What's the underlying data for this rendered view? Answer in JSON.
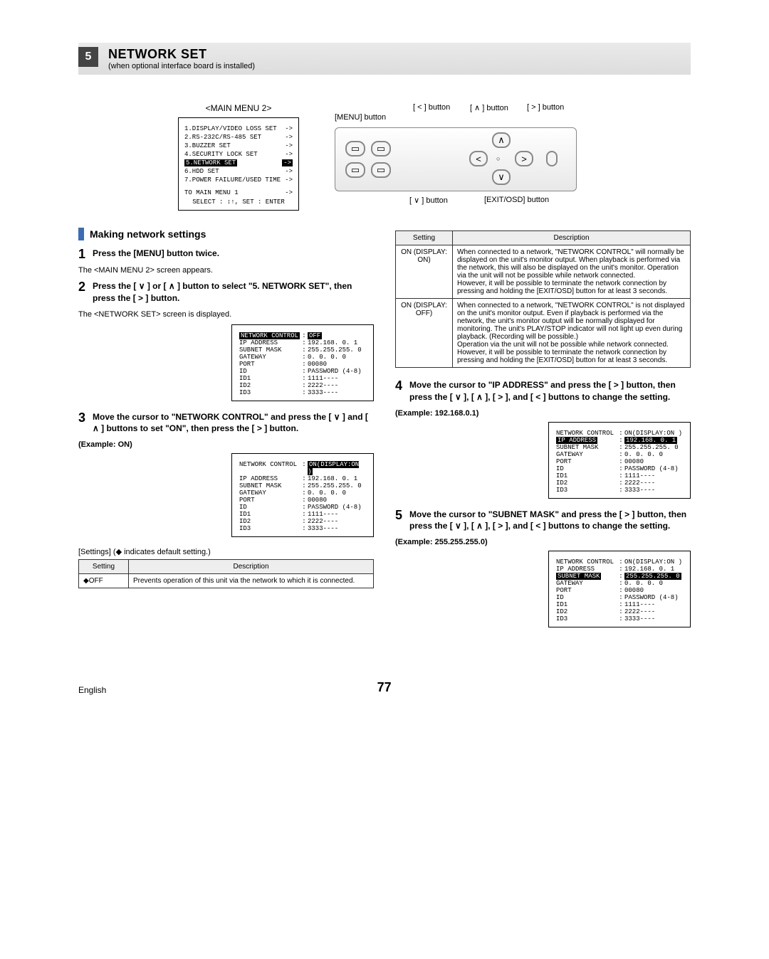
{
  "header": {
    "num": "5",
    "title": "NETWORK SET",
    "sub": "(when optional interface board is installed)"
  },
  "main_menu_label": "<MAIN MENU 2>",
  "main_menu": {
    "title": "<MAIN MENU 2>",
    "items": [
      {
        "t": "1.DISPLAY/VIDEO LOSS SET",
        "a": "->"
      },
      {
        "t": "2.RS-232C/RS-485 SET",
        "a": "->"
      },
      {
        "t": "3.BUZZER SET",
        "a": "->"
      },
      {
        "t": "4.SECURITY LOCK SET",
        "a": "->"
      },
      {
        "t": "5.NETWORK SET",
        "a": "->",
        "hl": true
      },
      {
        "t": "6.HDD SET",
        "a": "->"
      },
      {
        "t": "7.POWER FAILURE/USED TIME",
        "a": "->"
      }
    ],
    "foot1": "TO MAIN MENU 1",
    "foot1a": "->",
    "foot2": "SELECT : ↕↑,   SET : ENTER"
  },
  "device_labels": {
    "menu": "[MENU] button",
    "left": "[ < ] button",
    "up": "[ ∧ ] button",
    "right": "[ > ] button",
    "down": "[ ∨ ] button",
    "exit": "[EXIT/OSD] button"
  },
  "section_title": "Making network settings",
  "steps": {
    "s1": {
      "title": "Press the [MENU] button twice.",
      "note": "The <MAIN MENU 2> screen appears."
    },
    "s2": {
      "title": "Press the [ ∨ ] or [ ∧ ] button to select \"5. NETWORK SET\", then press the [ > ] button.",
      "note": "The <NETWORK SET> screen is displayed."
    },
    "s3": {
      "title": "Move the cursor to \"NETWORK CONTROL\" and press the [ ∨ ] and [ ∧ ] buttons to set \"ON\", then press the [ > ] button.",
      "ex": "(Example: ON)"
    },
    "s4": {
      "title": "Move the cursor to \"IP ADDRESS\" and press the [ > ] button, then press the [ ∨ ], [ ∧ ], [ > ], and [ < ] buttons to change the setting.",
      "ex": "(Example: 192.168.0.1)"
    },
    "s5": {
      "title": "Move the cursor to \"SUBNET MASK\" and press the [ > ] button, then press the [ ∨ ], [ ∧ ], [ > ], and [ < ] buttons to change the setting.",
      "ex": "(Example: 255.255.255.0)"
    }
  },
  "netbox_title": "<NETWORK SET>",
  "netbox_step2": {
    "rows": [
      {
        "k": "NETWORK CONTROL",
        "v": "OFF",
        "khl": true,
        "vhl": true
      },
      {
        "k": "IP ADDRESS",
        "v": "192.168.  0.  1"
      },
      {
        "k": "SUBNET MASK",
        "v": "255.255.255.  0"
      },
      {
        "k": "GATEWAY",
        "v": "  0.  0.  0.  0"
      },
      {
        "k": "PORT",
        "v": "00080"
      },
      {
        "k": "  ID",
        "v": "PASSWORD (4-8)"
      },
      {
        "k": "  ID1",
        "v": "1111----"
      },
      {
        "k": "  ID2",
        "v": "2222----"
      },
      {
        "k": "  ID3",
        "v": "3333----"
      }
    ]
  },
  "netbox_step3": {
    "rows": [
      {
        "k": "NETWORK CONTROL",
        "v": "ON(DISPLAY:ON )",
        "vhl": true
      },
      {
        "k": "IP ADDRESS",
        "v": "192.168.  0.  1"
      },
      {
        "k": "SUBNET MASK",
        "v": "255.255.255.  0"
      },
      {
        "k": "GATEWAY",
        "v": "  0.  0.  0.  0"
      },
      {
        "k": "PORT",
        "v": "00080"
      },
      {
        "k": "  ID",
        "v": "PASSWORD (4-8)"
      },
      {
        "k": "  ID1",
        "v": "1111----"
      },
      {
        "k": "  ID2",
        "v": "2222----"
      },
      {
        "k": "  ID3",
        "v": "3333----"
      }
    ]
  },
  "netbox_step4": {
    "rows": [
      {
        "k": "NETWORK CONTROL",
        "v": "ON(DISPLAY:ON )"
      },
      {
        "k": "IP ADDRESS",
        "v": "192.168.  0.  1",
        "khl": true,
        "vhl": true
      },
      {
        "k": "SUBNET MASK",
        "v": "255.255.255.  0"
      },
      {
        "k": "GATEWAY",
        "v": "  0.  0.  0.  0"
      },
      {
        "k": "PORT",
        "v": "00080"
      },
      {
        "k": "  ID",
        "v": "PASSWORD (4-8)"
      },
      {
        "k": "  ID1",
        "v": "1111----"
      },
      {
        "k": "  ID2",
        "v": "2222----"
      },
      {
        "k": "  ID3",
        "v": "3333----"
      }
    ]
  },
  "netbox_step5": {
    "rows": [
      {
        "k": "NETWORK CONTROL",
        "v": "ON(DISPLAY:ON )"
      },
      {
        "k": "IP ADDRESS",
        "v": "192.168.  0.  1"
      },
      {
        "k": "SUBNET MASK",
        "v": "255.255.255.  0",
        "khl": true,
        "vhl": true
      },
      {
        "k": "GATEWAY",
        "v": "  0.  0.  0.  0"
      },
      {
        "k": "PORT",
        "v": "00080"
      },
      {
        "k": "  ID",
        "v": "PASSWORD (4-8)"
      },
      {
        "k": "  ID1",
        "v": "1111----"
      },
      {
        "k": "  ID2",
        "v": "2222----"
      },
      {
        "k": "  ID3",
        "v": "3333----"
      }
    ]
  },
  "settings_label": "[Settings] (◆ indicates default setting.)",
  "settings_table": {
    "h1": "Setting",
    "h2": "Description",
    "rows": [
      {
        "s": "◆OFF",
        "d": "Prevents operation of this unit via the network to which it is connected."
      }
    ]
  },
  "settings_table2": {
    "h1": "Setting",
    "h2": "Description",
    "rows": [
      {
        "s": "ON (DISPLAY: ON)",
        "d": "When connected to a network, \"NETWORK CONTROL\" will normally be displayed on the unit's monitor output. When playback is performed via the network, this will also be displayed on the unit's monitor. Operation via the unit will not be possible while network connected.\nHowever, it will be possible to terminate the network connection by pressing and holding the [EXIT/OSD] button for at least 3 seconds."
      },
      {
        "s": "ON (DISPLAY: OFF)",
        "d": "When connected to a network, \"NETWORK CONTROL\" is not displayed on the unit's monitor output. Even if playback is performed via the network, the unit's monitor output will be normally displayed for monitoring. The unit's PLAY/STOP indicator will not light up even during playback. (Recording will be possible.)\nOperation via the unit will not be possible while network connected. However, it will be possible to terminate the network connection by pressing and holding the [EXIT/OSD] button for at least 3 seconds."
      }
    ]
  },
  "footer": {
    "lang": "English",
    "page": "77"
  }
}
